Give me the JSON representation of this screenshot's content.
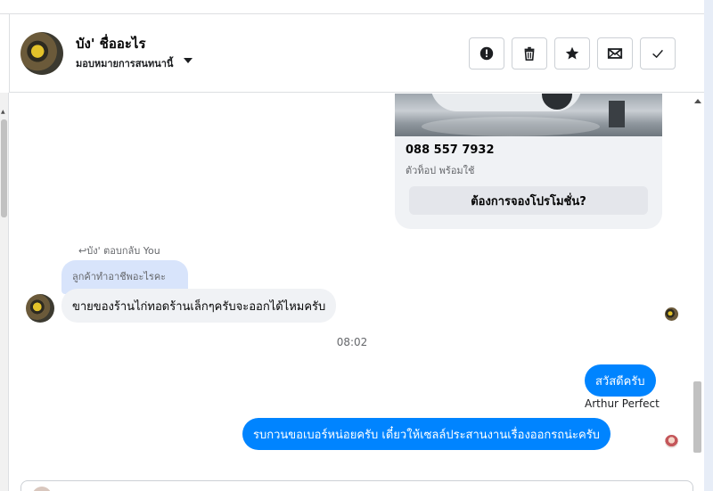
{
  "header": {
    "name": "บัง' ชื่ออะไร",
    "subtitle": "มอบหมายการสนทนานี้",
    "actions": [
      {
        "name": "report-button",
        "icon": "exclamation-icon"
      },
      {
        "name": "delete-button",
        "icon": "trash-icon"
      },
      {
        "name": "star-button",
        "icon": "star-icon"
      },
      {
        "name": "mail-button",
        "icon": "envelope-icon"
      },
      {
        "name": "done-button",
        "icon": "check-icon"
      }
    ]
  },
  "card": {
    "phone": "088 557 7932",
    "description": "ตัวท็อป พร้อมใช้",
    "button_label": "ต้องการจองโปรโมชั่น?"
  },
  "reply": {
    "meta": "บัง' ตอบกลับ You",
    "quote": "ลูกค้าทำอาชีพอะไรคะ",
    "message": "ขายของร้านไก่ทอดร้านเล็กๆครับจะออกได้ไหมครับ"
  },
  "timestamp": "08:02",
  "outgoing": [
    {
      "text": "สวัสดีครับ"
    },
    {
      "text": "รบกวนขอเบอร์หน่อยครับ เดี๋ยวให้เซลล์ประสานงานเรื่องออกรถน่ะครับ"
    }
  ],
  "sender_name": "Arthur Perfect",
  "colors": {
    "accent": "#0084ff",
    "incoming_bubble": "#f0f2f5",
    "quote_bubble": "#d8e4fb"
  }
}
